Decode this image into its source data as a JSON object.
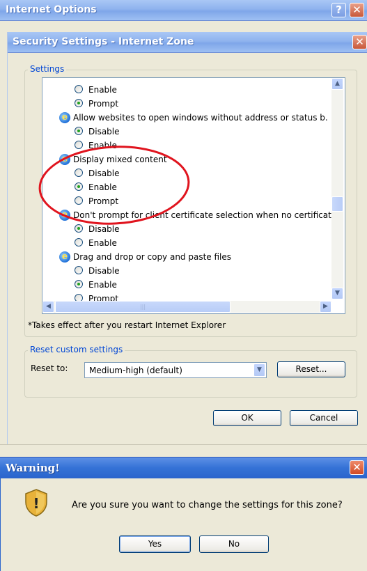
{
  "main_window": {
    "title": "Internet Options"
  },
  "security_dialog": {
    "title": "Security Settings - Internet Zone",
    "settings_group_label": "Settings",
    "settings_items": [
      {
        "type": "radio",
        "label": "Enable",
        "selected": false
      },
      {
        "type": "radio",
        "label": "Prompt",
        "selected": true
      },
      {
        "type": "category",
        "label": "Allow websites to open windows without address or status b."
      },
      {
        "type": "radio",
        "label": "Disable",
        "selected": true
      },
      {
        "type": "radio",
        "label": "Enable",
        "selected": false
      },
      {
        "type": "category",
        "label": "Display mixed content"
      },
      {
        "type": "radio",
        "label": "Disable",
        "selected": false
      },
      {
        "type": "radio",
        "label": "Enable",
        "selected": true
      },
      {
        "type": "radio",
        "label": "Prompt",
        "selected": false
      },
      {
        "type": "category",
        "label": "Don't prompt for client certificate selection when no certificat"
      },
      {
        "type": "radio",
        "label": "Disable",
        "selected": true
      },
      {
        "type": "radio",
        "label": "Enable",
        "selected": false
      },
      {
        "type": "category",
        "label": "Drag and drop or copy and paste files"
      },
      {
        "type": "radio",
        "label": "Disable",
        "selected": false
      },
      {
        "type": "radio",
        "label": "Enable",
        "selected": true
      },
      {
        "type": "radio",
        "label": "Prompt",
        "selected": false
      }
    ],
    "restart_note": "*Takes effect after you restart Internet Explorer",
    "reset_group_label": "Reset custom settings",
    "reset_to_label": "Reset to:",
    "reset_select_value": "Medium-high (default)",
    "reset_button": "Reset...",
    "ok_button": "OK",
    "cancel_button": "Cancel"
  },
  "warning_dialog": {
    "title": "Warning!",
    "message": "Are you sure you want to change the settings for this zone?",
    "yes_button": "Yes",
    "no_button": "No"
  },
  "colors": {
    "annotation_circle": "#e0141e",
    "group_label": "#0046d5"
  },
  "icons": {
    "category_icon": "internet-explorer-icon",
    "warning_icon": "security-shield-icon"
  }
}
